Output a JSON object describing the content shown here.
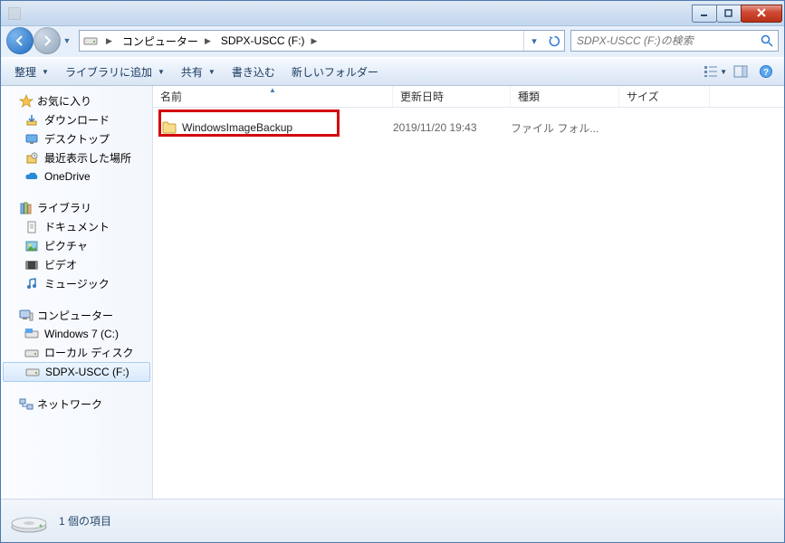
{
  "breadcrumb": {
    "seg1": "コンピューター",
    "seg2": "SDPX-USCC (F:)"
  },
  "search": {
    "placeholder": "SDPX-USCC (F:)の検索"
  },
  "toolbar": {
    "organize": "整理",
    "library": "ライブラリに追加",
    "share": "共有",
    "burn": "書き込む",
    "newfolder": "新しいフォルダー"
  },
  "sidebar": {
    "favorites": "お気に入り",
    "fav_items": [
      "ダウンロード",
      "デスクトップ",
      "最近表示した場所",
      "OneDrive"
    ],
    "libraries": "ライブラリ",
    "lib_items": [
      "ドキュメント",
      "ピクチャ",
      "ビデオ",
      "ミュージック"
    ],
    "computer": "コンピューター",
    "comp_items": [
      "Windows 7 (C:)",
      "ローカル ディスク",
      "SDPX-USCC (F:)"
    ],
    "network": "ネットワーク"
  },
  "columns": {
    "name": "名前",
    "date": "更新日時",
    "type": "種類",
    "size": "サイズ"
  },
  "rows": [
    {
      "name": "WindowsImageBackup",
      "date": "2019/11/20 19:43",
      "type": "ファイル フォル...",
      "size": ""
    }
  ],
  "status": {
    "count": "1 個の項目"
  }
}
